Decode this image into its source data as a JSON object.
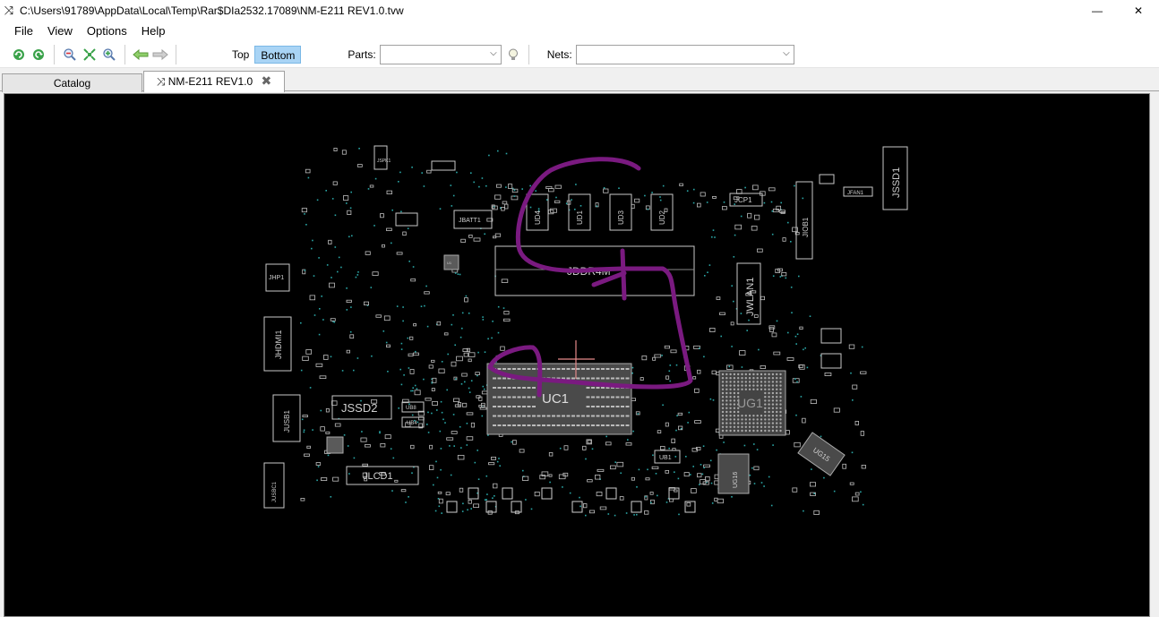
{
  "window": {
    "title": "C:\\Users\\91789\\AppData\\Local\\Temp\\Rar$DIa2532.17089\\NM-E211 REV1.0.tvw",
    "app_icon": "crossed-arrows-icon",
    "minimize_glyph": "—",
    "close_glyph": "✕"
  },
  "menu": [
    "File",
    "View",
    "Options",
    "Help"
  ],
  "toolbar": {
    "icons": [
      "rotate-left-icon",
      "rotate-right-icon",
      "zoom-out-icon",
      "zoom-fit-icon",
      "zoom-in-icon",
      "back-arrow-icon",
      "forward-arrow-icon"
    ],
    "top_label": "Top",
    "bottom_label": "Bottom",
    "active_layer": "Bottom",
    "parts_label": "Parts:",
    "parts_value": "",
    "nets_label": "Nets:",
    "nets_value": "",
    "bulb_icon": "bulb-icon"
  },
  "tabs": {
    "catalog": "Catalog",
    "document": "NM-E211 REV1.0",
    "document_icon": "crossed-arrows-icon",
    "close_glyph": "✖"
  },
  "board": {
    "labels": {
      "jspk": "JSPK1",
      "jbatt": "JBATT1",
      "jhp": "JHP1",
      "jhdmi": "JHDMI1",
      "jusb": "JUSB1",
      "jusbc": "JUSBC1",
      "jssd2": "JSSD2",
      "jlcd": "JLCD1",
      "uc1": "UC1",
      "ug1": "UG1",
      "ug16": "UG16",
      "ug15": "UG15",
      "ud1": "UD1",
      "ud2": "UD2",
      "ud3": "UD3",
      "ud4": "UD4",
      "jddim": "JDDR4M",
      "jcp1": "JCP1",
      "jiob1": "JIOB1",
      "jfan1": "JFAN1",
      "jssd1": "JSSD1",
      "jwlan1": "JWLAN1",
      "ub1": "UB1",
      "ub4": "UB4",
      "ub8": "UB8",
      "u1": "U1"
    },
    "annotation_color": "#7a1a80"
  }
}
